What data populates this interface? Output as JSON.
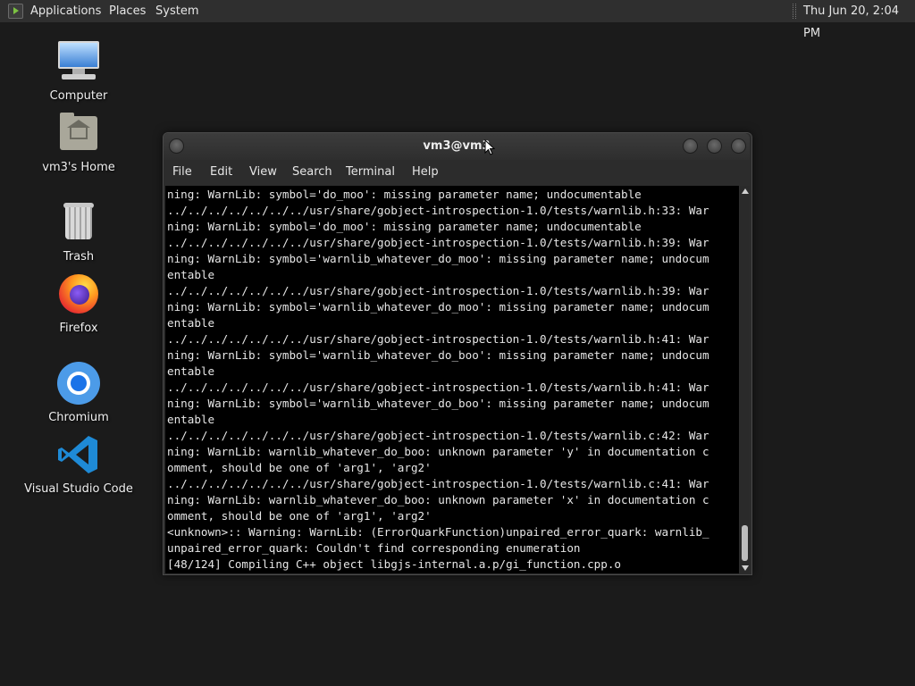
{
  "top_panel": {
    "menus": [
      "Applications",
      "Places",
      "System"
    ],
    "clock": "Thu Jun 20, 2:04 PM"
  },
  "desktop": {
    "icons": [
      {
        "label": "Computer",
        "icon": "computer-icon"
      },
      {
        "label": "vm3's Home",
        "icon": "home-folder-icon"
      },
      {
        "label": "Trash",
        "icon": "trash-icon"
      },
      {
        "label": "Firefox",
        "icon": "firefox-icon"
      },
      {
        "label": "Chromium",
        "icon": "chromium-icon"
      },
      {
        "label": "Visual Studio Code",
        "icon": "vscode-icon"
      }
    ]
  },
  "terminal": {
    "title": "vm3@vm3",
    "menu": [
      "File",
      "Edit",
      "View",
      "Search",
      "Terminal",
      "Help"
    ],
    "lines": [
      "ning: WarnLib: symbol='do_moo': missing parameter name; undocumentable",
      "../../../../../../../usr/share/gobject-introspection-1.0/tests/warnlib.h:33: War",
      "ning: WarnLib: symbol='do_moo': missing parameter name; undocumentable",
      "../../../../../../../usr/share/gobject-introspection-1.0/tests/warnlib.h:39: War",
      "ning: WarnLib: symbol='warnlib_whatever_do_moo': missing parameter name; undocum",
      "entable",
      "../../../../../../../usr/share/gobject-introspection-1.0/tests/warnlib.h:39: War",
      "ning: WarnLib: symbol='warnlib_whatever_do_moo': missing parameter name; undocum",
      "entable",
      "../../../../../../../usr/share/gobject-introspection-1.0/tests/warnlib.h:41: War",
      "ning: WarnLib: symbol='warnlib_whatever_do_boo': missing parameter name; undocum",
      "entable",
      "../../../../../../../usr/share/gobject-introspection-1.0/tests/warnlib.h:41: War",
      "ning: WarnLib: symbol='warnlib_whatever_do_boo': missing parameter name; undocum",
      "entable",
      "../../../../../../../usr/share/gobject-introspection-1.0/tests/warnlib.c:42: War",
      "ning: WarnLib: warnlib_whatever_do_boo: unknown parameter 'y' in documentation c",
      "omment, should be one of 'arg1', 'arg2'",
      "../../../../../../../usr/share/gobject-introspection-1.0/tests/warnlib.c:41: War",
      "ning: WarnLib: warnlib_whatever_do_boo: unknown parameter 'x' in documentation c",
      "omment, should be one of 'arg1', 'arg2'",
      "<unknown>:: Warning: WarnLib: (ErrorQuarkFunction)unpaired_error_quark: warnlib_",
      "unpaired_error_quark: Couldn't find corresponding enumeration",
      "[48/124] Compiling C++ object libgjs-internal.a.p/gi_function.cpp.o"
    ]
  },
  "colors": {
    "panel_bg": "#2f2f2f",
    "desktop_bg": "#1b1b1b",
    "terminal_bg": "#000000",
    "terminal_fg": "#e6e6e6"
  }
}
